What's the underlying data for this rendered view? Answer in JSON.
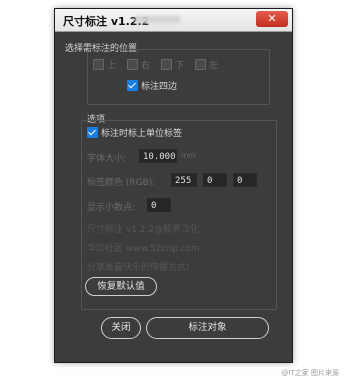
{
  "window": {
    "title": "尺寸标注 v1.2.2",
    "close_label": "✕"
  },
  "position_group": {
    "title": "选择需标注的位置",
    "sides": [
      "上",
      "右",
      "下",
      "左"
    ],
    "all_sides_label": "标注四边",
    "all_sides_checked": true
  },
  "options": {
    "title": "选项",
    "unit_label": "标注时标上单位标签",
    "unit_checked": true,
    "font_size_label": "字体大小:",
    "font_size_value": "10.000",
    "font_size_unit": "mm",
    "color_label": "标签颜色 (RGB):",
    "color_r": "255",
    "color_g": "0",
    "color_b": "0",
    "decimal_label": "显示小数点:",
    "decimal_value": "0",
    "credit1": "尺寸标注 v1.2.2@软界汉化",
    "credit2": "华印社区  www.52cnp.com",
    "credit3": "分享是最快乐的传播方式!",
    "reset_label": "恢复默认值"
  },
  "footer": {
    "close_label": "关闭",
    "apply_label": "标注对象"
  },
  "watermark": "@IT之家 图片来源"
}
